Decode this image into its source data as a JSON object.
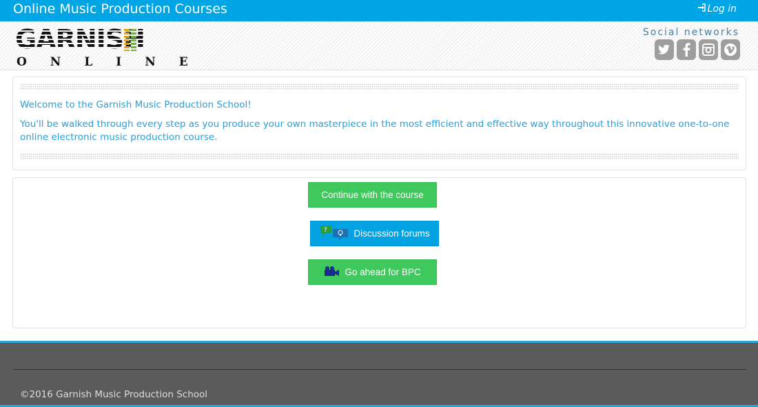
{
  "topbar": {
    "site_title": "Online Music Production Courses",
    "login_label": "Log in",
    "login_icon": "sign-in-icon"
  },
  "header": {
    "logo_word": "GARNISH",
    "logo_sub": "ONLINE",
    "social_label": "Social networks",
    "social_icons": [
      "twitter-icon",
      "facebook-icon",
      "instagram-icon",
      "vimeo-icon"
    ]
  },
  "welcome": {
    "heading": "Welcome to the Garnish Music Production School!",
    "body": "You'll be walked through every step as you produce your own masterpiece in the most efficient and effective way throughout this innovative one-to-one online electronic music production course."
  },
  "actions": {
    "continue_label": "Continue with the course",
    "forums_label": "Discussion forums",
    "bpc_label": "Go ahead for BPC"
  },
  "footer": {
    "copyright": "©2016 Garnish Music Production School"
  },
  "colors": {
    "primary_blue": "#00a5e6",
    "button_green": "#3fc95c",
    "text_blue": "#2a9fd6",
    "footer_gray": "#5b5b5b",
    "icon_gray": "#9e9e9e"
  }
}
